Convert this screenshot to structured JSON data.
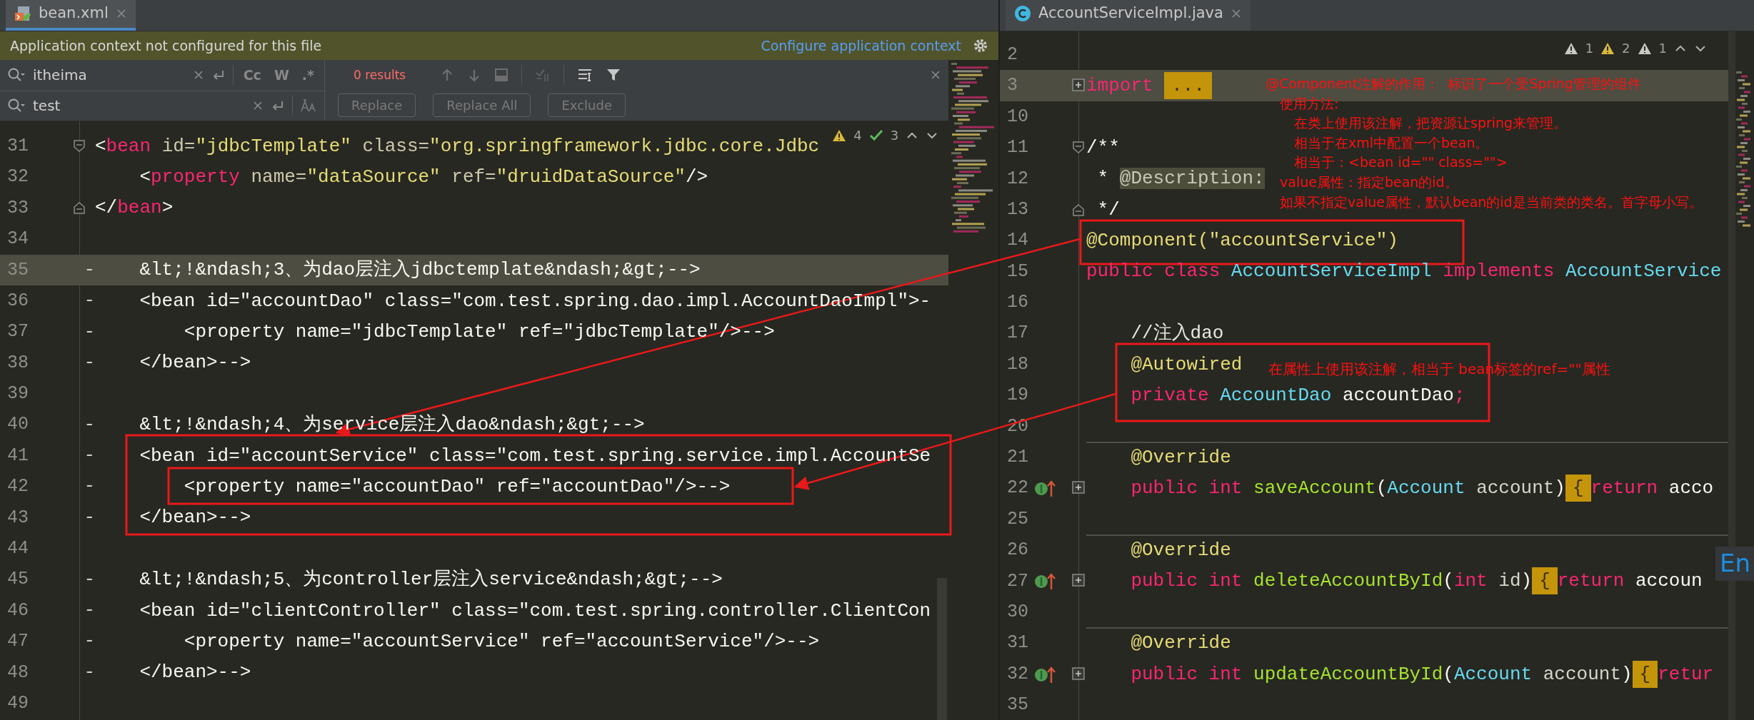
{
  "left_pane": {
    "tab": {
      "label": "bean.xml",
      "selected": true
    },
    "banner": {
      "message": "Application context not configured for this file",
      "link": "Configure application context"
    },
    "find": {
      "search": {
        "value": "itheima"
      },
      "search_options": [
        {
          "label": "Cc",
          "on": false
        },
        {
          "label": "W",
          "on": false
        },
        {
          "label": ".*",
          "on": false
        }
      ],
      "replace": {
        "value": "test"
      },
      "replace_options": [
        {
          "kind": "preserve_case",
          "on": false
        }
      ],
      "results": "0 results",
      "buttons": [
        {
          "label": "Replace",
          "disabled": true
        },
        {
          "label": "Replace All",
          "disabled": true
        },
        {
          "label": "Exclude",
          "disabled": true
        }
      ]
    },
    "inspections": [
      {
        "kind": "warning",
        "count": "4"
      },
      {
        "kind": "ok",
        "count": "3"
      }
    ],
    "lines": [
      {
        "number": "31",
        "current": false,
        "fold": {
          "kind": "start"
        },
        "tokens": [
          {
            "kind": "p",
            "text": "<"
          },
          {
            "kind": "tag",
            "text": "bean"
          },
          {
            "kind": "attr",
            "text": " id="
          },
          {
            "kind": "str",
            "text": "\"jdbcTemplate\""
          },
          {
            "kind": "attr",
            "text": " class="
          },
          {
            "kind": "str",
            "text": "\"org.springframework.jdbc.core.Jdbc"
          }
        ]
      },
      {
        "number": "32",
        "current": false,
        "tokens": [
          {
            "kind": "p",
            "text": "    <"
          },
          {
            "kind": "tag",
            "text": "property"
          },
          {
            "kind": "attr",
            "text": " name="
          },
          {
            "kind": "str",
            "text": "\"dataSource\""
          },
          {
            "kind": "attr",
            "text": " ref="
          },
          {
            "kind": "str",
            "text": "\"druidDataSource\""
          },
          {
            "kind": "p",
            "text": "/>"
          }
        ]
      },
      {
        "number": "33",
        "current": false,
        "fold": {
          "kind": "end"
        },
        "tokens": [
          {
            "kind": "p",
            "text": "</"
          },
          {
            "kind": "tag",
            "text": "bean"
          },
          {
            "kind": "p",
            "text": ">"
          }
        ]
      },
      {
        "number": "34",
        "current": false
      },
      {
        "number": "35",
        "current": true,
        "marker": "-",
        "tokens": [
          {
            "kind": "p",
            "text": "    &lt;!&ndash;3、为dao层注入jdbctemplate&ndash;&gt;-->"
          }
        ]
      },
      {
        "number": "36",
        "current": false,
        "marker": "-",
        "tokens": [
          {
            "kind": "p",
            "text": "    <bean id=\"accountDao\" class=\"com.test.spring.dao.impl.AccountDaoImpl\">-"
          }
        ]
      },
      {
        "number": "37",
        "current": false,
        "marker": "-",
        "tokens": [
          {
            "kind": "p",
            "text": "        <property name=\"jdbcTemplate\" ref=\"jdbcTemplate\"/>-->"
          }
        ]
      },
      {
        "number": "38",
        "current": false,
        "marker": "-",
        "tokens": [
          {
            "kind": "p",
            "text": "    </bean>-->"
          }
        ]
      },
      {
        "number": "39",
        "current": false
      },
      {
        "number": "40",
        "current": false,
        "marker": "-",
        "tokens": [
          {
            "kind": "p",
            "text": "    &lt;!&ndash;4、为service层注入dao&ndash;&gt;-->"
          }
        ]
      },
      {
        "number": "41",
        "current": false,
        "marker": "-",
        "tokens": [
          {
            "kind": "p",
            "text": "    <bean id=\"accountService\" class=\"com.test.spring.service.impl.AccountSe"
          }
        ]
      },
      {
        "number": "42",
        "current": false,
        "marker": "-",
        "tokens": [
          {
            "kind": "p",
            "text": "        <property name=\"accountDao\" ref=\"accountDao\"/>-->"
          }
        ]
      },
      {
        "number": "43",
        "current": false,
        "marker": "-",
        "tokens": [
          {
            "kind": "p",
            "text": "    </bean>-->"
          }
        ]
      },
      {
        "number": "44",
        "current": false
      },
      {
        "number": "45",
        "current": false,
        "marker": "-",
        "tokens": [
          {
            "kind": "p",
            "text": "    &lt;!&ndash;5、为controller层注入service&ndash;&gt;-->"
          }
        ]
      },
      {
        "number": "46",
        "current": false,
        "marker": "-",
        "tokens": [
          {
            "kind": "p",
            "text": "    <bean id=\"clientController\" class=\"com.test.spring.controller.ClientCon"
          }
        ]
      },
      {
        "number": "47",
        "current": false,
        "marker": "-",
        "tokens": [
          {
            "kind": "p",
            "text": "        <property name=\"accountService\" ref=\"accountService\"/>-->"
          }
        ]
      },
      {
        "number": "48",
        "current": false,
        "marker": "-",
        "tokens": [
          {
            "kind": "p",
            "text": "    </bean>-->"
          }
        ]
      },
      {
        "number": "49",
        "current": false
      }
    ]
  },
  "right_pane": {
    "tab": {
      "label": "AccountServiceImpl.java",
      "selected": false
    },
    "inspections": [
      {
        "kind": "weak",
        "count": "1"
      },
      {
        "kind": "warning",
        "count": "2"
      },
      {
        "kind": "weak",
        "count": "1"
      }
    ],
    "lines": [
      {
        "number": "2",
        "current": false,
        "separator": false
      },
      {
        "number": "3",
        "current": true,
        "separator": false,
        "fold": {
          "kind": "collapsed"
        },
        "tokens": [
          {
            "kind": "kw",
            "text": "import "
          },
          {
            "kind": "fold",
            "text": "..."
          }
        ]
      },
      {
        "number": "10",
        "current": false,
        "separator": false
      },
      {
        "number": "11",
        "current": false,
        "separator": false,
        "fold": {
          "kind": "start"
        },
        "tokens": [
          {
            "kind": "p",
            "text": "/**"
          }
        ]
      },
      {
        "number": "12",
        "current": false,
        "separator": false,
        "tokens": [
          {
            "kind": "p",
            "text": " * "
          },
          {
            "kind": "doc",
            "text": "@Description:"
          }
        ]
      },
      {
        "number": "13",
        "current": false,
        "separator": false,
        "fold": {
          "kind": "end"
        },
        "tokens": [
          {
            "kind": "p",
            "text": " */"
          }
        ]
      },
      {
        "number": "14",
        "current": false,
        "separator": false,
        "tokens": [
          {
            "kind": "ann",
            "text": "@Component("
          },
          {
            "kind": "str",
            "text": "\"accountService\""
          },
          {
            "kind": "ann",
            "text": ")"
          }
        ]
      },
      {
        "number": "15",
        "current": false,
        "separator": false,
        "tokens": [
          {
            "kind": "kw",
            "text": "public class "
          },
          {
            "kind": "type",
            "text": "AccountServiceImpl "
          },
          {
            "kind": "kw",
            "text": "implements "
          },
          {
            "kind": "type",
            "text": "AccountService"
          }
        ]
      },
      {
        "number": "16",
        "current": false,
        "separator": false
      },
      {
        "number": "17",
        "current": false,
        "separator": false,
        "tokens": [
          {
            "kind": "cmt",
            "text": "    //注入dao"
          }
        ]
      },
      {
        "number": "18",
        "current": false,
        "separator": false,
        "tokens": [
          {
            "kind": "ann",
            "text": "    @Autowired"
          }
        ]
      },
      {
        "number": "19",
        "current": false,
        "separator": false,
        "tokens": [
          {
            "kind": "kw",
            "text": "    private "
          },
          {
            "kind": "type",
            "text": "AccountDao "
          },
          {
            "kind": "p",
            "text": "accountDao"
          },
          {
            "kind": "kw",
            "text": ";"
          }
        ]
      },
      {
        "number": "20",
        "current": false,
        "separator": false
      },
      {
        "number": "21",
        "current": false,
        "separator": true,
        "tokens": [
          {
            "kind": "ann",
            "text": "    @Override"
          }
        ]
      },
      {
        "number": "22",
        "current": false,
        "separator": false,
        "gutter_icon": {
          "kind": "implements"
        },
        "fold": {
          "kind": "collapsed"
        },
        "tokens": [
          {
            "kind": "kw",
            "text": "    public int "
          },
          {
            "kind": "fn",
            "text": "saveAccount"
          },
          {
            "kind": "p",
            "text": "("
          },
          {
            "kind": "type",
            "text": "Account "
          },
          {
            "kind": "param",
            "text": "account"
          },
          {
            "kind": "p",
            "text": ")"
          },
          {
            "kind": "fold",
            "text": "{"
          },
          {
            "kind": "kw",
            "text": "return "
          },
          {
            "kind": "p",
            "text": "acco"
          }
        ]
      },
      {
        "number": "25",
        "current": false,
        "separator": false
      },
      {
        "number": "26",
        "current": false,
        "separator": true,
        "tokens": [
          {
            "kind": "ann",
            "text": "    @Override"
          }
        ]
      },
      {
        "number": "27",
        "current": false,
        "separator": false,
        "gutter_icon": {
          "kind": "implements"
        },
        "fold": {
          "kind": "collapsed"
        },
        "tokens": [
          {
            "kind": "kw",
            "text": "    public int "
          },
          {
            "kind": "fn",
            "text": "deleteAccountById"
          },
          {
            "kind": "p",
            "text": "("
          },
          {
            "kind": "kw",
            "text": "int "
          },
          {
            "kind": "param",
            "text": "id"
          },
          {
            "kind": "p",
            "text": ")"
          },
          {
            "kind": "fold",
            "text": "{"
          },
          {
            "kind": "kw",
            "text": "return "
          },
          {
            "kind": "p",
            "text": "accoun"
          }
        ]
      },
      {
        "number": "30",
        "current": false,
        "separator": false
      },
      {
        "number": "31",
        "current": false,
        "separator": true,
        "tokens": [
          {
            "kind": "ann",
            "text": "    @Override"
          }
        ]
      },
      {
        "number": "32",
        "current": false,
        "separator": false,
        "gutter_icon": {
          "kind": "implements"
        },
        "fold": {
          "kind": "collapsed"
        },
        "tokens": [
          {
            "kind": "kw",
            "text": "    public int "
          },
          {
            "kind": "fn",
            "text": "updateAccountById"
          },
          {
            "kind": "p",
            "text": "("
          },
          {
            "kind": "type",
            "text": "Account "
          },
          {
            "kind": "param",
            "text": "account"
          },
          {
            "kind": "p",
            "text": ")"
          },
          {
            "kind": "fold",
            "text": "{"
          },
          {
            "kind": "kw",
            "text": "retur"
          }
        ]
      },
      {
        "number": "35",
        "current": false,
        "separator": false
      }
    ],
    "notes": [
      "@Component注解的作用：  标识了一个受Spring管理的组件",
      "  使用方法:",
      "    在类上使用该注解，把资源让spring来管理。",
      "    相当于在xml中配置一个bean。",
      "    相当于：<bean id=\"\" class=\"\">",
      "  value属性：指定bean的id。",
      "  如果不指定value属性，默认bean的id是当前类的类名。首字母小写。"
    ],
    "field_note": "在属性上使用该注解，相当于 bean标签的ref=\"\"属性",
    "ime": "En"
  }
}
